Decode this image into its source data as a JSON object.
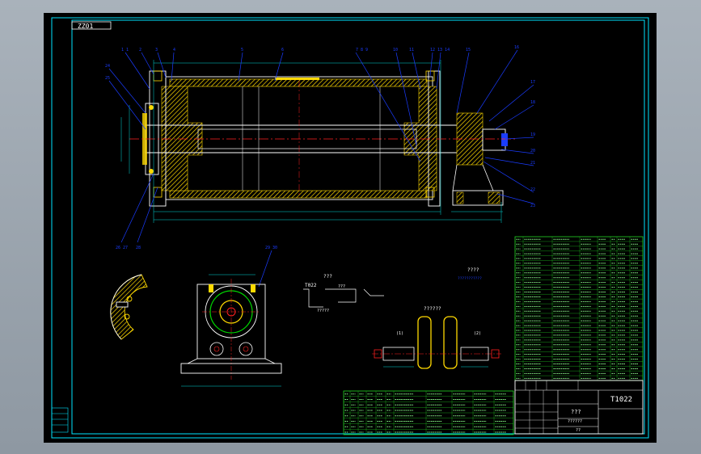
{
  "drawing": {
    "top_left_label": "ZZ01",
    "view_note_a": "T022",
    "view_note_b": "???",
    "view_note_c": "??????",
    "tech_req_title": "????",
    "tech_req_line": "???????????",
    "tech_label_a": "???",
    "tech_label_b": "?????",
    "roller_title": "??????",
    "seq_a": "(1)",
    "seq_b": "(2)"
  },
  "title_block": {
    "drawing_number": "T1022",
    "name": "???",
    "subtitle": "??????",
    "school": "??"
  },
  "colors": {
    "background": "#000000",
    "border": "#00e5ff",
    "outline": "#ffffff",
    "section": "#ffd900",
    "leader": "#1a3cff",
    "centerline": "#ff2020",
    "table": "#22d822",
    "dimension": "#00d8d8"
  }
}
